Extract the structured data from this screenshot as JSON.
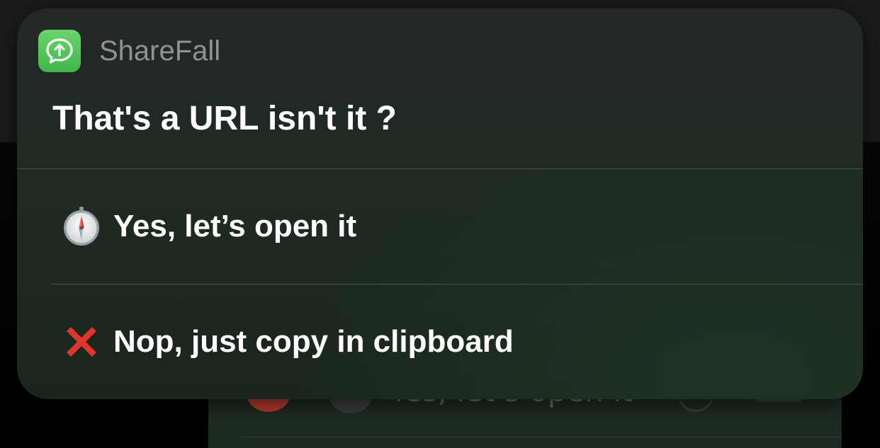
{
  "background": {
    "action_label": "Yes, let’s open it"
  },
  "notification": {
    "app_name": "ShareFall",
    "app_icon": "chat-upload-icon",
    "title": "That's a URL isn't it ?",
    "actions": [
      {
        "icon": "compass-icon",
        "label": "Yes, let’s open it"
      },
      {
        "icon": "cross-mark-icon",
        "label": "Nop, just copy in clipboard"
      }
    ]
  },
  "colors": {
    "app_icon_green": "#4cc05a",
    "cross_red": "#e0352b"
  }
}
